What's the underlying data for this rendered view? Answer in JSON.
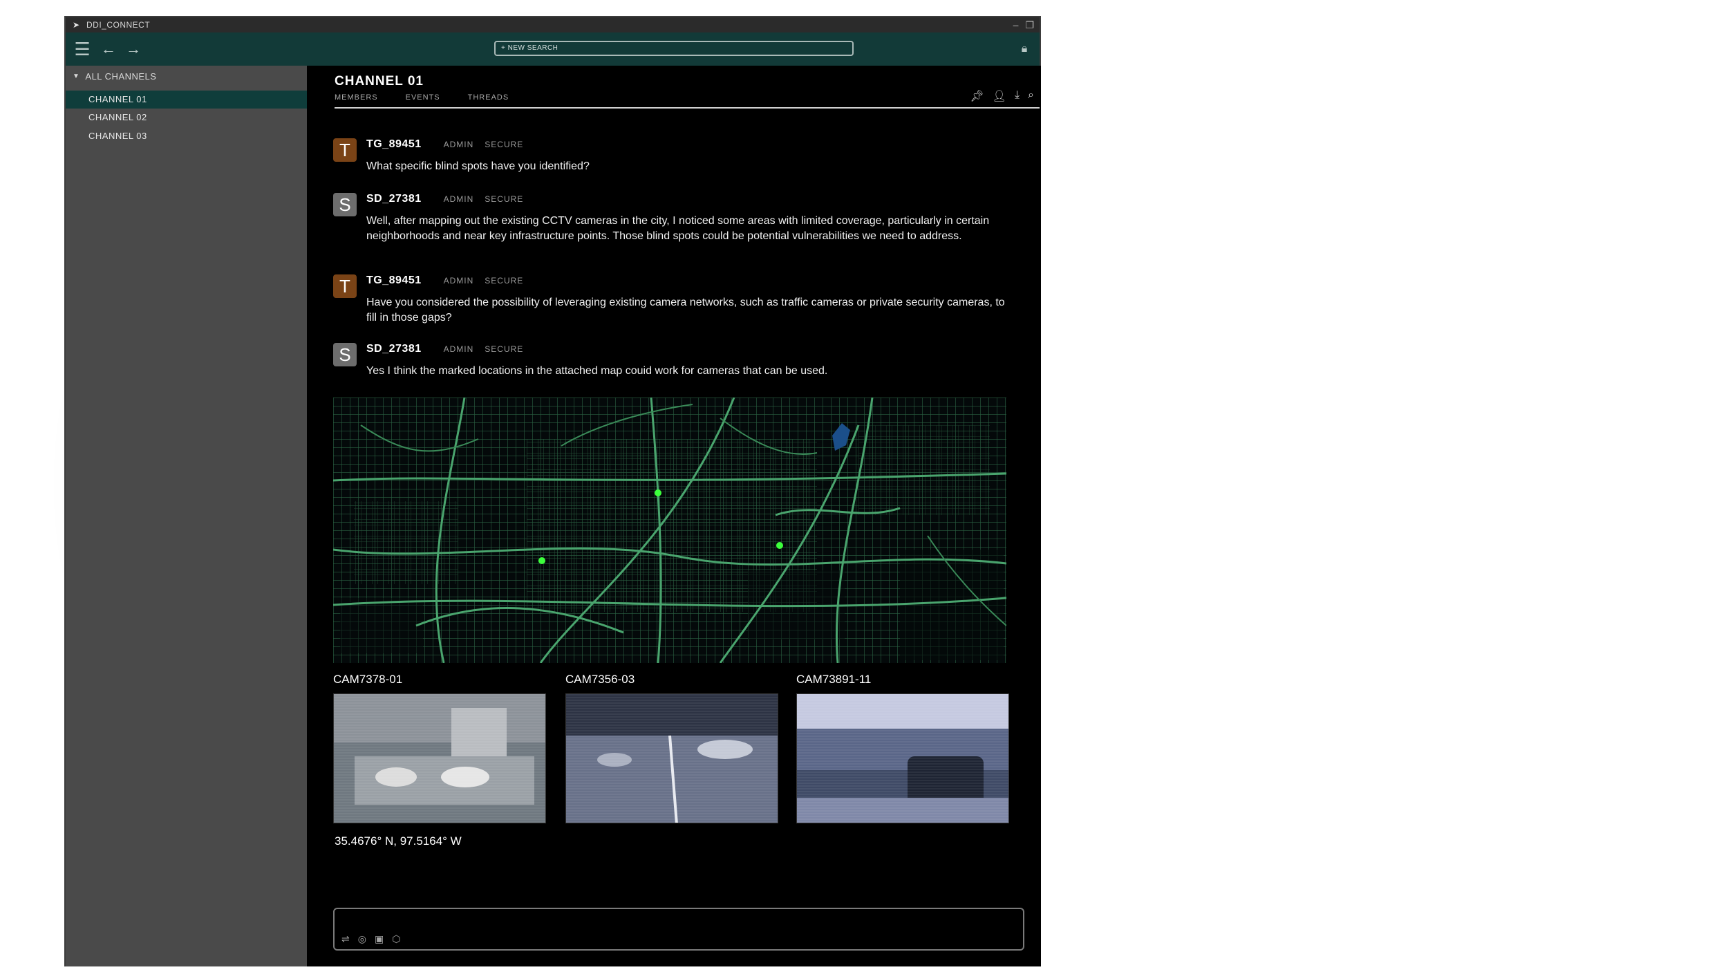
{
  "window": {
    "title": "DDI_CONNECT"
  },
  "toolbar": {
    "search_label": "+ NEW SEARCH",
    "menu_icon": "hamburger-icon",
    "back_icon": "back-arrow-icon",
    "forward_icon": "forward-arrow-icon",
    "lock_icon": "lock-icon"
  },
  "sidebar": {
    "header": "ALL CHANNELS",
    "items": [
      {
        "label": "CHANNEL 01",
        "active": true
      },
      {
        "label": "CHANNEL 02",
        "active": false
      },
      {
        "label": "CHANNEL 03",
        "active": false
      }
    ]
  },
  "channel": {
    "title": "CHANNEL 01",
    "tabs": [
      "MEMBERS",
      "EVENTS",
      "THREADS"
    ],
    "header_icons": [
      "pin-icon",
      "user-icon",
      "download-icon",
      "search-icon"
    ]
  },
  "messages": [
    {
      "avatar": "T",
      "user": "TG_89451",
      "role": "ADMIN",
      "status": "SECURE",
      "text": "What specific blind spots have you identified?"
    },
    {
      "avatar": "S",
      "user": "SD_27381",
      "role": "ADMIN",
      "status": "SECURE",
      "text": "Well, after mapping out the existing CCTV cameras in the city, I noticed some areas with limited coverage, particularly in certain neighborhoods and near key infrastructure points. Those blind spots could be potential vulnerabilities we need to address."
    },
    {
      "avatar": "T",
      "user": "TG_89451",
      "role": "ADMIN",
      "status": "SECURE",
      "text": "Have you considered the possibility of leveraging existing camera networks, such as traffic cameras or private security cameras, to fill in those gaps?"
    },
    {
      "avatar": "S",
      "user": "SD_27381",
      "role": "ADMIN",
      "status": "SECURE",
      "text": "Yes I think the marked locations in the attached map couid work for cameras that can be used."
    }
  ],
  "cameras": [
    {
      "label": "CAM7378-01"
    },
    {
      "label": "CAM7356-03"
    },
    {
      "label": "CAM73891-11"
    }
  ],
  "coordinates": "35.4676° N, 97.5164° W",
  "composer": {
    "icons": [
      "filter-icon",
      "location-pin-icon",
      "save-icon",
      "cube-icon"
    ]
  },
  "colors": {
    "toolbar": "#123a38",
    "sidebar": "#4a4a4a",
    "active_item": "#0f3d3b",
    "map_roads": "#3f8a5c",
    "map_marker": "#3cff3c",
    "avatar_T": "#7a4316",
    "avatar_S": "#6d6d6d"
  }
}
